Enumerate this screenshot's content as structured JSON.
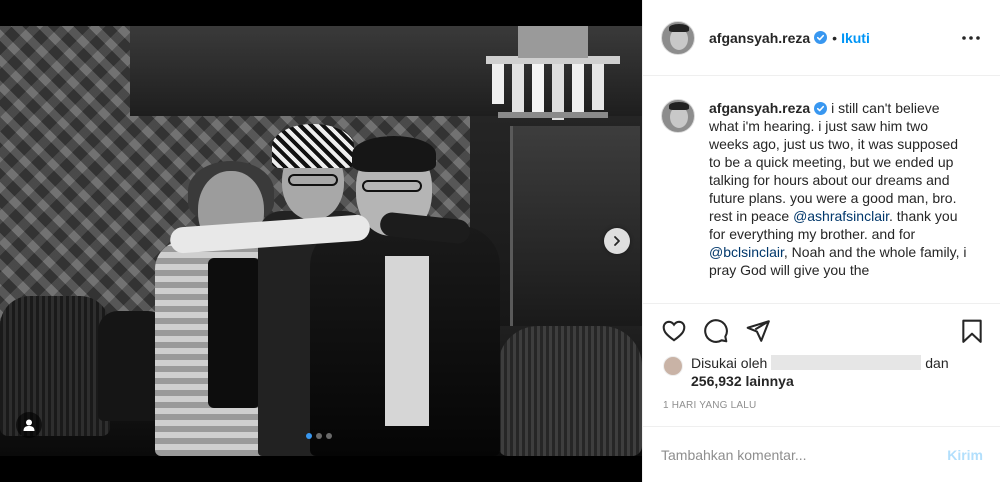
{
  "post": {
    "username": "afgansyah.reza",
    "bullet": "•",
    "follow_label": "Ikuti",
    "caption_user": "afgansyah.reza",
    "caption_part1": "i still can't believe what i'm hearing. i just saw him two weeks ago, just us two, it was supposed to be a quick meeting, but we ended up talking for hours about our dreams and future plans. you were a good man, bro. rest in peace",
    "mention1": "@ashrafsinclair",
    "caption_part2": ". thank you for everything my brother. and for",
    "mention2": "@bclsinclair",
    "caption_part3": ", Noah and the whole family, i pray God will give you the",
    "liked_prefix": "Disukai oleh",
    "liked_and": "dan",
    "likes_count": "256,932 lainnya",
    "time_ago": "1 HARI YANG LALU",
    "comment_placeholder": "Tambahkan komentar...",
    "post_button": "Kirim"
  },
  "icons": {
    "verified": "verified-badge-icon",
    "more": "more-options-icon",
    "like": "heart-icon",
    "comment": "comment-icon",
    "share": "share-icon",
    "save": "bookmark-icon",
    "next": "chevron-right-icon",
    "tag": "user-tag-icon"
  },
  "colors": {
    "accent": "#0095f6",
    "verified": "#3897f0",
    "mention": "#00376b",
    "muted": "#8e8e8e"
  },
  "carousel": {
    "current_slide": 1,
    "total_slides": 3
  }
}
